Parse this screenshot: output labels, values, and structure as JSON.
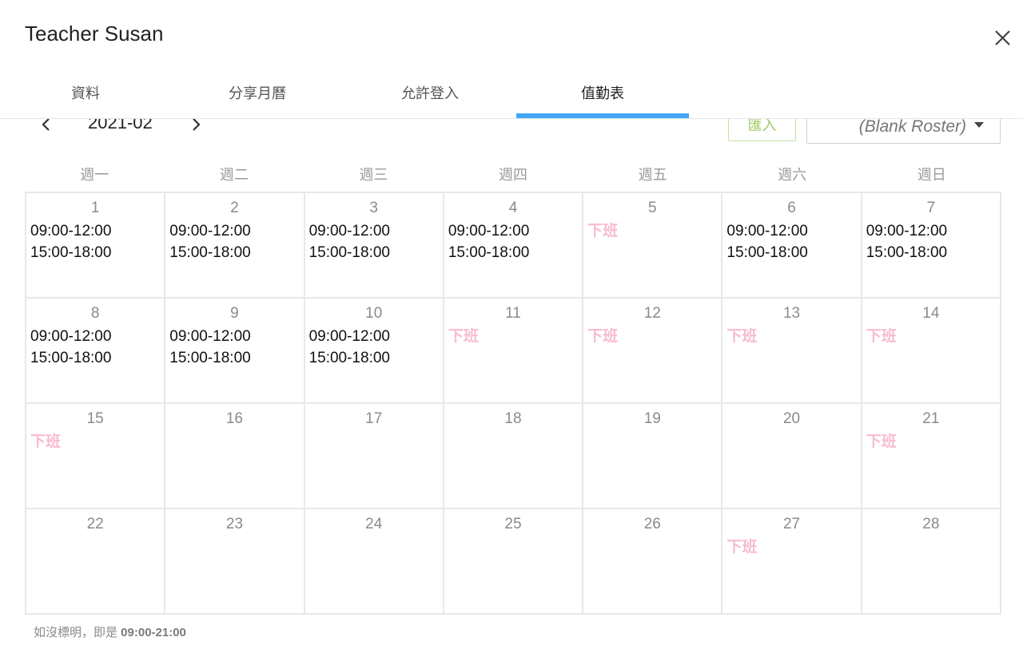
{
  "window": {
    "title": "Teacher Susan"
  },
  "tabs": [
    {
      "label": "資料"
    },
    {
      "label": "分享月曆"
    },
    {
      "label": "允許登入"
    },
    {
      "label": "值勤表"
    }
  ],
  "tab_colors": {
    "active_indicator": "#42a5f5"
  },
  "toolbar": {
    "month": "2021-02",
    "import_label": "匯入",
    "roster_value": "(Blank Roster)",
    "icons": [
      "chevron-left-icon",
      "chevron-right-icon",
      "caret-down-icon",
      "close-icon"
    ]
  },
  "weekdays": [
    "週一",
    "週二",
    "週三",
    "週四",
    "週五",
    "週六",
    "週日"
  ],
  "calendar": {
    "days": [
      {
        "day": "1",
        "entries": [
          "09:00-12:00",
          "15:00-18:00"
        ]
      },
      {
        "day": "2",
        "entries": [
          "09:00-12:00",
          "15:00-18:00"
        ]
      },
      {
        "day": "3",
        "entries": [
          "09:00-12:00",
          "15:00-18:00"
        ]
      },
      {
        "day": "4",
        "entries": [
          "09:00-12:00",
          "15:00-18:00"
        ]
      },
      {
        "day": "5",
        "off": "下班"
      },
      {
        "day": "6",
        "entries": [
          "09:00-12:00",
          "15:00-18:00"
        ]
      },
      {
        "day": "7",
        "entries": [
          "09:00-12:00",
          "15:00-18:00"
        ]
      },
      {
        "day": "8",
        "entries": [
          "09:00-12:00",
          "15:00-18:00"
        ]
      },
      {
        "day": "9",
        "entries": [
          "09:00-12:00",
          "15:00-18:00"
        ]
      },
      {
        "day": "10",
        "entries": [
          "09:00-12:00",
          "15:00-18:00"
        ]
      },
      {
        "day": "11",
        "off": "下班"
      },
      {
        "day": "12",
        "off": "下班"
      },
      {
        "day": "13",
        "off": "下班"
      },
      {
        "day": "14",
        "off": "下班"
      },
      {
        "day": "15",
        "off": "下班"
      },
      {
        "day": "16"
      },
      {
        "day": "17"
      },
      {
        "day": "18"
      },
      {
        "day": "19"
      },
      {
        "day": "20"
      },
      {
        "day": "21",
        "off": "下班"
      },
      {
        "day": "22"
      },
      {
        "day": "23"
      },
      {
        "day": "24"
      },
      {
        "day": "25"
      },
      {
        "day": "26"
      },
      {
        "day": "27",
        "off": "下班"
      },
      {
        "day": "28"
      }
    ],
    "colors": {
      "off": "#f8bbd0",
      "shift": "#111111"
    }
  },
  "footer": {
    "note_prefix": "如沒標明，即是 ",
    "note_default_hours": "09:00-21:00"
  }
}
